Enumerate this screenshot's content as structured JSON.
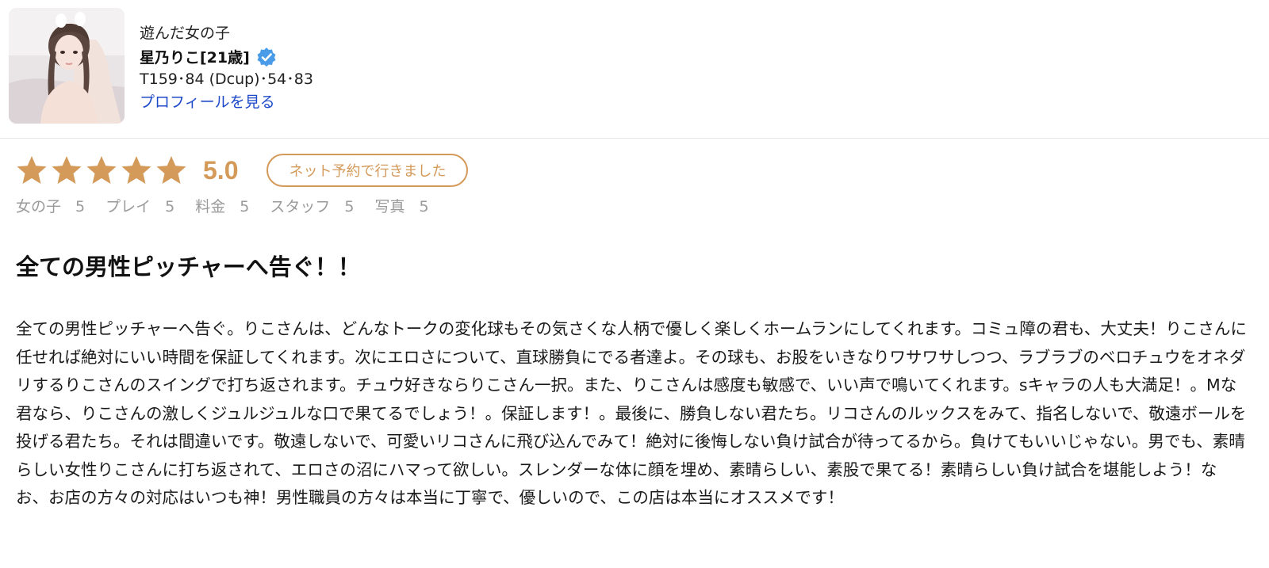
{
  "profile": {
    "played_label": "遊んだ女の子",
    "name": "星乃りこ[21歳]",
    "verified_icon": "verified-check-icon",
    "specs": "T159･84 (Dcup)･54･83",
    "profile_link": "プロフィールを見る"
  },
  "rating": {
    "stars": 5,
    "score": "5.0",
    "booking_badge": "ネット予約で行きました",
    "star_color": "#d49a5a",
    "categories": [
      {
        "label": "女の子",
        "value": "5"
      },
      {
        "label": "プレイ",
        "value": "5"
      },
      {
        "label": "料金",
        "value": "5"
      },
      {
        "label": "スタッフ",
        "value": "5"
      },
      {
        "label": "写真",
        "value": "5"
      }
    ]
  },
  "review": {
    "title": "全ての男性ピッチャーへ告ぐ！！",
    "body": "全ての男性ピッチャーへ告ぐ。りこさんは、どんなトークの変化球もその気さくな人柄で優しく楽しくホームランにしてくれます。コミュ障の君も、大丈夫！りこさんに任せれば絶対にいい時間を保証してくれます。次にエロさについて、直球勝負にでる者達よ。その球も、お股をいきなりワサワサしつつ、ラブラブのベロチュウをオネダリするりこさんのスイングで打ち返されます。チュウ好きならりこさん一択。また、りこさんは感度も敏感で、いい声で鳴いてくれます。sキャラの人も大満足！。Mな君なら、りこさんの激しくジュルジュルな口で果てるでしょう！。保証します！。最後に、勝負しない君たち。リコさんのルックスをみて、指名しないで、敬遠ボールを投げる君たち。それは間違いです。敬遠しないで、可愛いリコさんに飛び込んでみて！絶対に後悔しない負け試合が待ってるから。負けてもいいじゃない。男でも、素晴らしい女性りこさんに打ち返されて、エロさの沼にハマって欲しい。スレンダーな体に顔を埋め、素晴らしい、素股で果てる！素晴らしい負け試合を堪能しよう！なお、お店の方々の対応はいつも神！男性職員の方々は本当に丁寧で、優しいので、この店は本当にオススメです！"
  },
  "colors": {
    "accent": "#d49a5a",
    "link": "#1d49c9",
    "verified": "#4a9be8",
    "muted": "#9a9a9a"
  }
}
